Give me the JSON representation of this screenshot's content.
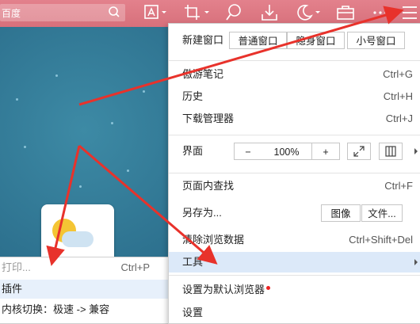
{
  "toolbar": {
    "search_text": "百度",
    "tools": [
      "screenshot-icon",
      "crop-icon",
      "search-tool-icon",
      "download-icon",
      "night-mode-icon",
      "toolbox-icon",
      "more-icon",
      "menu-icon"
    ]
  },
  "menu": {
    "new_window_label": "新建窗口",
    "window_buttons": [
      "普通窗口",
      "隐身窗口",
      "小号窗口"
    ],
    "items_group1": [
      {
        "label": "傲游笔记",
        "shortcut": "Ctrl+G"
      },
      {
        "label": "历史",
        "shortcut": "Ctrl+H"
      },
      {
        "label": "下载管理器",
        "shortcut": "Ctrl+J"
      }
    ],
    "zoom_label": "界面",
    "zoom_minus": "−",
    "zoom_value": "100%",
    "zoom_plus": "+",
    "find_label": "页面内查找",
    "find_shortcut": "Ctrl+F",
    "save_label": "另存为...",
    "save_buttons": [
      "图像",
      "文件..."
    ],
    "clear_label": "清除浏览数据",
    "clear_shortcut": "Ctrl+Shift+Del",
    "tools_label": "工具",
    "default_label": "设置为默认浏览器",
    "settings_label": "设置"
  },
  "submenu": {
    "items": [
      {
        "label": "打印...",
        "shortcut": "Ctrl+P"
      },
      {
        "label": "插件",
        "shortcut": ""
      },
      {
        "label": "内核切换：极速 -> 兼容",
        "shortcut": ""
      }
    ]
  },
  "colors": {
    "toolbar": "#d7707b",
    "highlight": "#dce9f9",
    "annotation_arrow": "#e8322b"
  }
}
